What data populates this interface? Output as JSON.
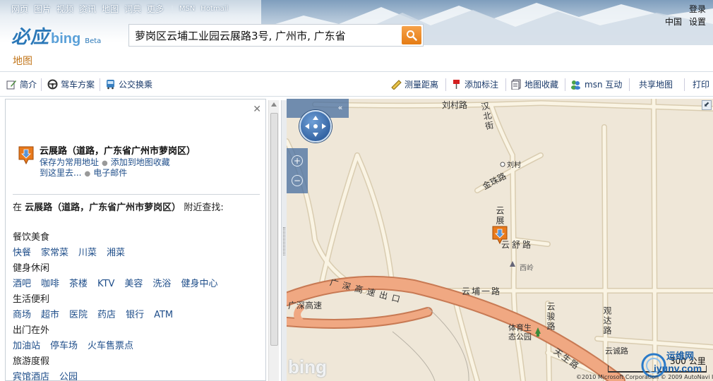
{
  "topnav": {
    "items": [
      "网页",
      "图片",
      "视频",
      "资讯",
      "地图",
      "词典",
      "更多"
    ],
    "msn": "MSN",
    "hotmail": "Hotmail",
    "login": "登录",
    "region": "中国",
    "settings": "设置"
  },
  "logo": {
    "cn": "必应",
    "en": "bing",
    "beta": "Beta"
  },
  "search": {
    "value": "萝岗区云埔工业园云展路3号, 广州市, 广东省"
  },
  "map_section_title": "地图",
  "toolbar": {
    "intro": "简介",
    "driving": "驾车方案",
    "transit": "公交换乘",
    "measure": "测量距离",
    "add_marker": "添加标注",
    "favorites": "地图收藏",
    "msn_interact": "msn 互动",
    "share": "共享地图",
    "print": "打印"
  },
  "result": {
    "title": "云展路（道路，广东省广州市萝岗区）",
    "save_address": "保存为常用地址",
    "add_to_favorites": "添加到地图收藏",
    "directions_to": "到这里去...",
    "email": "电子邮件"
  },
  "nearby": {
    "prefix": "在",
    "place": "云展路（道路，广东省广州市萝岗区）",
    "suffix": "附近查找:",
    "categories": [
      {
        "name": "餐饮美食",
        "links": [
          "快餐",
          "家常菜",
          "川菜",
          "湘菜"
        ]
      },
      {
        "name": "健身休闲",
        "links": [
          "酒吧",
          "咖啡",
          "茶楼",
          "KTV",
          "美容",
          "洗浴",
          "健身中心"
        ]
      },
      {
        "name": "生活便利",
        "links": [
          "商场",
          "超市",
          "医院",
          "药店",
          "银行",
          "ATM"
        ]
      },
      {
        "name": "出门在外",
        "links": [
          "加油站",
          "停车场",
          "火车售票点"
        ]
      },
      {
        "name": "旅游度假",
        "links": [
          "宾馆酒店",
          "公园"
        ]
      }
    ]
  },
  "map": {
    "labels": {
      "liucun_road": "刘村路",
      "hanbei_street": "汉北街",
      "liucun": "刘村",
      "jinzhu_road": "金珠路",
      "yunzhan": "云展",
      "yunshu_road": "云舒路",
      "xiling": "西岭",
      "yunpu_1_road": "云埔一路",
      "guangshen_exit": "广深高速出口",
      "guangshen_hw": "广深高速",
      "yunjun_road": "云骏路",
      "guanda_road": "观达路",
      "sports_park": "体育生态公园",
      "tiansheng_road": "天生路",
      "yuncheng_road": "云诚路"
    },
    "scale": "300 公里",
    "copyright": "©2010 Microsoft Corporation    © 2009 AutoNavi Inc.",
    "watermark_bing": "bing",
    "watermark_site_cn": "运维网",
    "watermark_site_en": "iyunv.com",
    "colors": {
      "highway": "#f0a882",
      "road": "#faf4e4",
      "map_bg": "#efe7d8"
    }
  }
}
